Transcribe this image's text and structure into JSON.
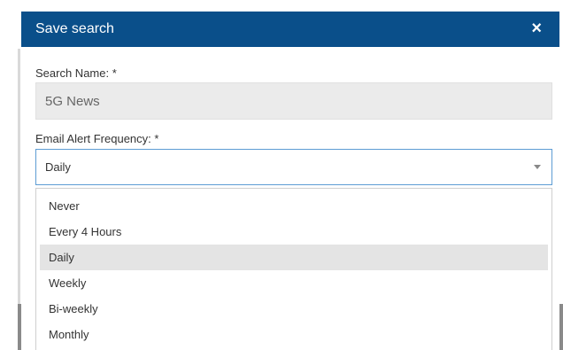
{
  "dialog": {
    "title": "Save search",
    "close_glyph": "×"
  },
  "form": {
    "name_label": "Search Name: *",
    "name_value": "5G News",
    "frequency_label": "Email Alert Frequency: *",
    "frequency_selected": "Daily"
  },
  "dropdown": {
    "options": [
      "Never",
      "Every 4 Hours",
      "Daily",
      "Weekly",
      "Bi-weekly",
      "Monthly"
    ],
    "highlighted": "Daily"
  },
  "colors": {
    "header": "#0a4f8a",
    "select_border": "#5d9cd4",
    "highlight": "#e4e4e4"
  },
  "icons": {
    "close": "close-icon",
    "chevron": "chevron-down-icon"
  }
}
